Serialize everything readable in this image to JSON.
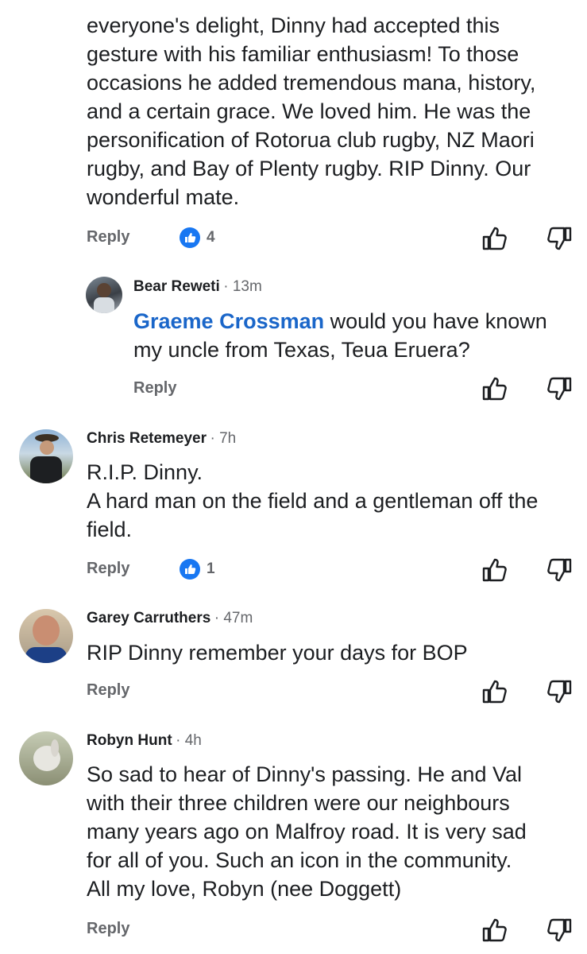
{
  "comments": [
    {
      "body": "everyone's delight, Dinny had accepted this\ngesture with his familiar enthusiasm! To those\noccasions he added tremendous mana, history,\nand a certain grace. We loved him. He was the\npersonification of Rotorua club rugby, NZ Maori\nrugby, and Bay of Plenty rugby. RIP Dinny.  Our\nwonderful mate.",
      "reply_label": "Reply",
      "like_count": "4",
      "icons": [
        "like-badge-icon",
        "thumbs-up-icon",
        "thumbs-down-icon"
      ]
    },
    {
      "author": "Bear Reweti",
      "time": "· 13m",
      "mention": "Graeme Crossman",
      "body": " would you have known\nmy uncle from Texas, Teua Eruera?",
      "reply_label": "Reply"
    },
    {
      "author": "Chris Retemeyer",
      "time": "· 7h",
      "body": "R.I.P. Dinny.\nA hard man on the field and a gentleman off the\nfield.",
      "reply_label": "Reply",
      "like_count": "1"
    },
    {
      "author": "Garey Carruthers",
      "time": "· 47m",
      "body": "RIP Dinny remember your days for BOP",
      "reply_label": "Reply"
    },
    {
      "author": "Robyn Hunt",
      "time": "· 4h",
      "body": "So sad to hear of Dinny's passing.  He and Val\nwith their three children were our neighbours\nmany years ago on Malfroy road.  It is very sad\nfor all of you.  Such an icon in the community.\nAll my love, Robyn (nee Doggett)",
      "reply_label": "Reply"
    }
  ],
  "colors": {
    "accent": "#1877f2",
    "mention": "#1a66c9",
    "muted": "#65676b",
    "text": "#1c1e21"
  }
}
